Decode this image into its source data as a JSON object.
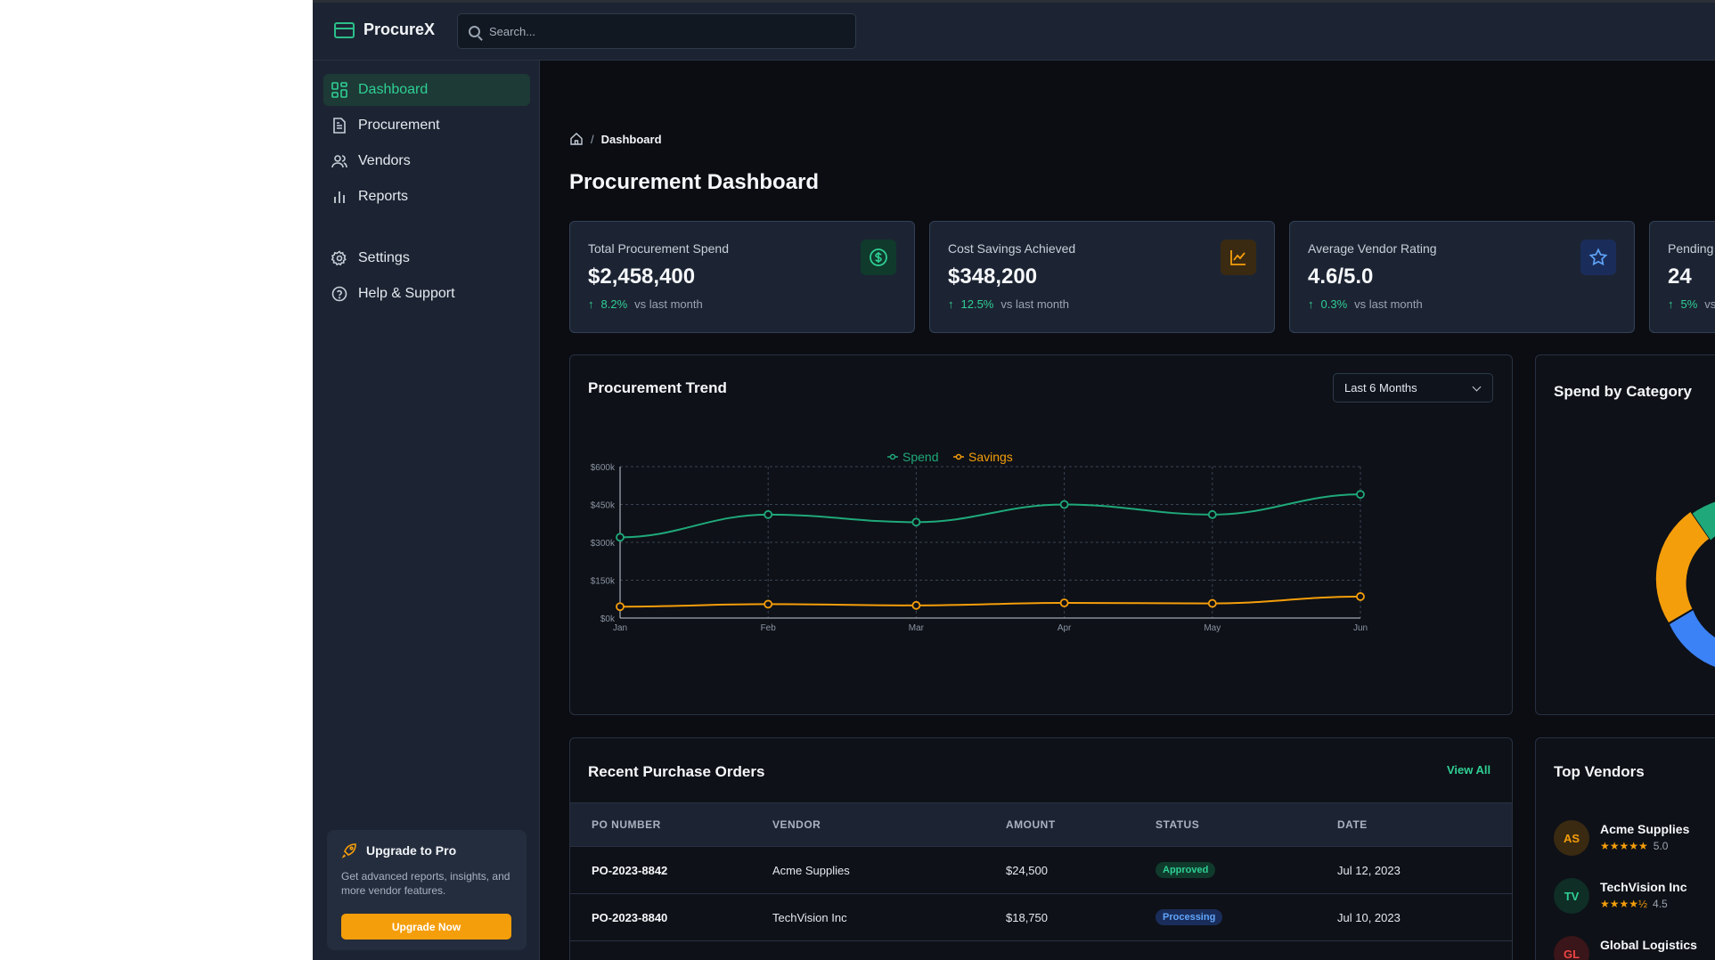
{
  "app": {
    "name": "ProcureX"
  },
  "search": {
    "placeholder": "Search..."
  },
  "sidebar": {
    "items": [
      {
        "label": "Dashboard",
        "icon": "dashboard-icon",
        "active": true
      },
      {
        "label": "Procurement",
        "icon": "document-icon"
      },
      {
        "label": "Vendors",
        "icon": "users-icon"
      },
      {
        "label": "Reports",
        "icon": "bar-chart-icon"
      },
      {
        "label": "Settings",
        "icon": "gear-icon"
      },
      {
        "label": "Help & Support",
        "icon": "help-icon"
      }
    ],
    "upgrade": {
      "title": "Upgrade to Pro",
      "text": "Get advanced reports, insights, and more vendor features.",
      "button": "Upgrade Now"
    }
  },
  "breadcrumb": {
    "separator": "/",
    "current": "Dashboard"
  },
  "page": {
    "title": "Procurement Dashboard"
  },
  "kpis": [
    {
      "label": "Total Procurement Spend",
      "value": "$2,458,400",
      "change": "8.2%",
      "suffix": "vs last month",
      "icon": "dollar-icon",
      "accent": "#2fcf94"
    },
    {
      "label": "Cost Savings Achieved",
      "value": "$348,200",
      "change": "12.5%",
      "suffix": "vs last month",
      "icon": "trend-chart-icon",
      "accent": "#f59e0b"
    },
    {
      "label": "Average Vendor Rating",
      "value": "4.6/5.0",
      "change": "0.3%",
      "suffix": "vs last month",
      "icon": "star-icon",
      "accent": "#3b82f6"
    },
    {
      "label": "Pending",
      "value": "24",
      "change": "5%",
      "suffix": "vs last month",
      "icon": "",
      "accent": "#2fcf94"
    }
  ],
  "trend": {
    "title": "Procurement Trend",
    "range": "Last 6 Months"
  },
  "chart_data": {
    "type": "line",
    "x": [
      "Jan",
      "Feb",
      "Mar",
      "Apr",
      "May",
      "Jun"
    ],
    "series": [
      {
        "name": "Spend",
        "color": "#1fa97a",
        "values": [
          320000,
          410000,
          380000,
          450000,
          410000,
          490000
        ]
      },
      {
        "name": "Savings",
        "color": "#f59e0b",
        "values": [
          45000,
          55000,
          50000,
          60000,
          58000,
          85000
        ]
      }
    ],
    "yticks": [
      "$0k",
      "$150k",
      "$300k",
      "$450k",
      "$600k"
    ],
    "ylim": [
      0,
      600000
    ],
    "grid": true,
    "legend": "top-center"
  },
  "category": {
    "title": "Spend by Category",
    "colors": [
      "#1fa97a",
      "#f59e0b",
      "#3b82f6"
    ]
  },
  "orders": {
    "title": "Recent Purchase Orders",
    "view_all": "View All",
    "columns": [
      "PO NUMBER",
      "VENDOR",
      "AMOUNT",
      "STATUS",
      "DATE"
    ],
    "rows": [
      {
        "po": "PO-2023-8842",
        "vendor": "Acme Supplies",
        "amount": "$24,500",
        "status": "Approved",
        "date": "Jul 12, 2023",
        "status_color": "#2fcf94",
        "status_bg": "#0f3a2c"
      },
      {
        "po": "PO-2023-8840",
        "vendor": "TechVision Inc",
        "amount": "$18,750",
        "status": "Processing",
        "date": "Jul 10, 2023",
        "status_color": "#60a5fa",
        "status_bg": "#1a2d5a"
      }
    ]
  },
  "vendors": {
    "title": "Top Vendors",
    "items": [
      {
        "initials": "AS",
        "name": "Acme Supplies",
        "stars": "★★★★★",
        "rating": "5.0",
        "color": "#f59e0b",
        "bg": "#3a2a12"
      },
      {
        "initials": "TV",
        "name": "TechVision Inc",
        "stars": "★★★★½",
        "rating": "4.5",
        "color": "#2fcf94",
        "bg": "#0f2e26"
      },
      {
        "initials": "GL",
        "name": "Global Logistics",
        "stars": "",
        "rating": "",
        "color": "#ef4444",
        "bg": "#3a1519"
      }
    ]
  }
}
